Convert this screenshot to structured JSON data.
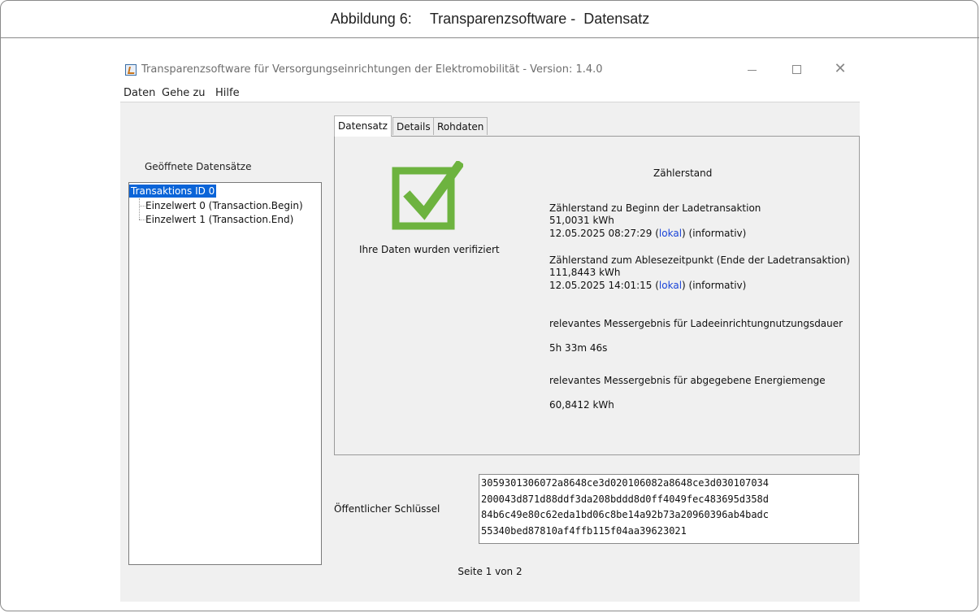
{
  "caption": {
    "label": "Abbildung 6:",
    "title": "Transparenzsoftware -  Datensatz"
  },
  "window": {
    "title": "Transparenzsoftware für Versorgungseinrichtungen der Elektromobilität - Version: 1.4.0"
  },
  "menu": {
    "items": [
      "Daten",
      "Gehe zu",
      "Hilfe"
    ]
  },
  "tree": {
    "heading": "Geöffnete Datensätze",
    "root": "Transaktions ID 0",
    "children": [
      "Einzelwert 0 (Transaction.Begin)",
      "Einzelwert 1 (Transaction.End)"
    ]
  },
  "tabs": [
    "Datensatz",
    "Details",
    "Rohdaten"
  ],
  "verification": {
    "icon": "check-icon",
    "color": "#6db33f",
    "text": "Ihre Daten wurden verifiziert"
  },
  "meter": {
    "title": "Zählerstand",
    "begin_label": "Zählerstand zu Beginn der Ladetransaktion",
    "begin_value": "51,0031 kWh",
    "begin_time": "12.05.2025 08:27:29",
    "end_label": "Zählerstand zum Ablesezeitpunkt (Ende der Ladetransaktion)",
    "end_value": "111,8443 kWh",
    "end_time": "12.05.2025 14:01:15",
    "time_link": "lokal",
    "informative": "(informativ)",
    "duration_label": "relevantes Messergebnis für Ladeeinrichtungnutzungsdauer",
    "duration_value": "5h 33m 46s",
    "energy_label": "relevantes Messergebnis für abgegebene Energiemenge",
    "energy_value": "60,8412 kWh"
  },
  "public_key": {
    "label": "Öffentlicher Schlüssel",
    "lines": [
      "3059301306072a8648ce3d020106082a8648ce3d030107034",
      "200043d871d88ddf3da208bddd8d0ff4049fec483695d358d",
      "84b6c49e80c62eda1bd06c8be14a92b73a20960396ab4badc",
      "55340bed87810af4ffb115f04aa39623021"
    ]
  },
  "pagination": "Seite 1 von 2"
}
